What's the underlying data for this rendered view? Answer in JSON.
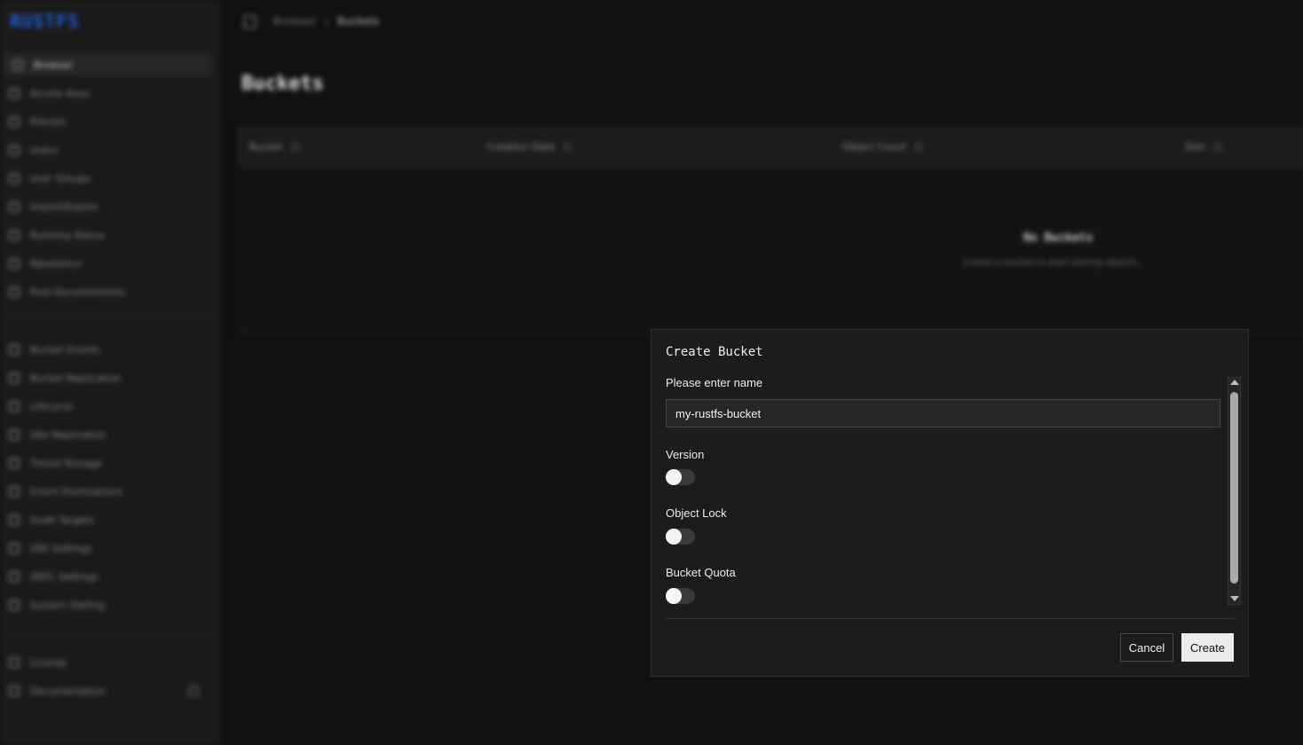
{
  "sidebar": {
    "logo": "RUSTFS",
    "group1": [
      {
        "label": "Browser",
        "active": true
      },
      {
        "label": "Access Keys"
      },
      {
        "label": "Policies"
      },
      {
        "label": "Users"
      },
      {
        "label": "User Groups"
      },
      {
        "label": "Import/Export"
      },
      {
        "label": "Running Status"
      },
      {
        "label": "Rebalance"
      },
      {
        "label": "Pool Decommission"
      }
    ],
    "group2": [
      {
        "label": "Bucket Events"
      },
      {
        "label": "Bucket Replication"
      },
      {
        "label": "Lifecycle"
      },
      {
        "label": "Site Replication"
      },
      {
        "label": "Tiered Storage"
      },
      {
        "label": "Event Destinations"
      },
      {
        "label": "Audit Targets"
      },
      {
        "label": "SSE Settings"
      },
      {
        "label": "OIDC Settings"
      },
      {
        "label": "System Setting"
      }
    ],
    "group3": [
      {
        "label": "License"
      },
      {
        "label": "Documentation"
      }
    ]
  },
  "breadcrumb": {
    "root": "Browser",
    "separator": "/",
    "current": "Buckets"
  },
  "page": {
    "title": "Buckets"
  },
  "table": {
    "columns": [
      "Bucket",
      "Creation Date",
      "Object Count",
      "Size"
    ],
    "empty_title": "No Buckets",
    "empty_subtitle": "Create a bucket to start storing objects"
  },
  "modal": {
    "title": "Create Bucket",
    "name_label": "Please enter name",
    "name_value": "my-rustfs-bucket",
    "version_label": "Version",
    "version_on": false,
    "object_lock_label": "Object Lock",
    "object_lock_on": false,
    "quota_label": "Bucket Quota",
    "quota_on": false,
    "cancel_label": "Cancel",
    "create_label": "Create"
  }
}
